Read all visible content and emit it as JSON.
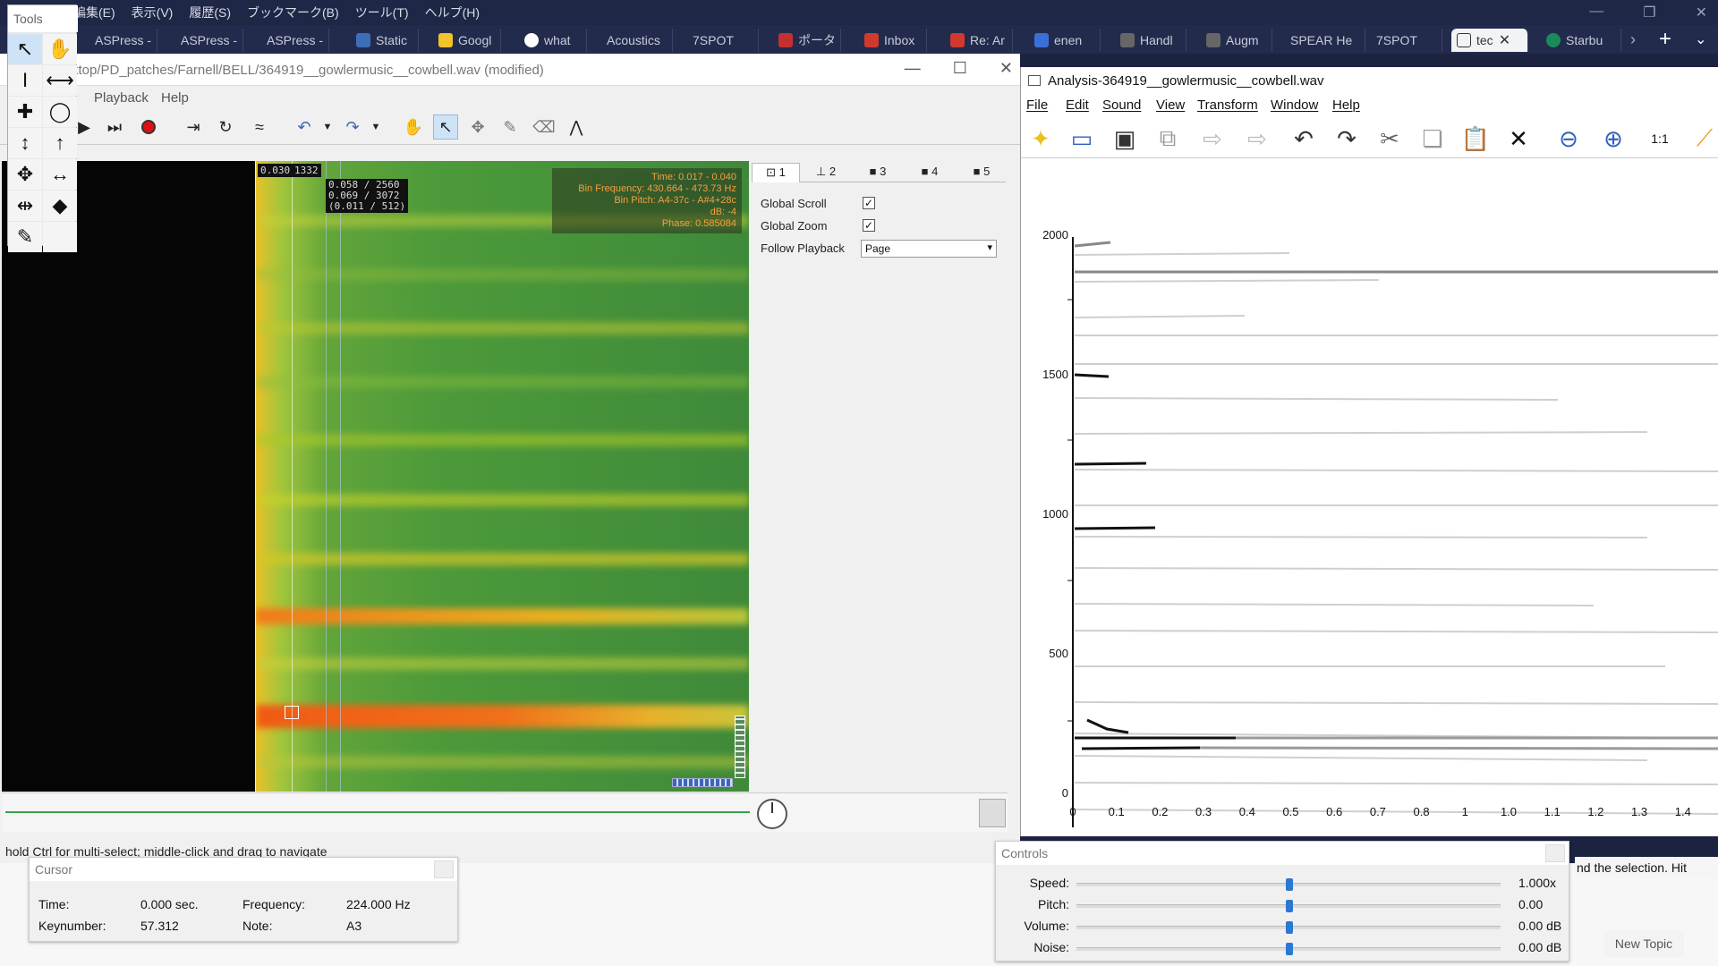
{
  "browser": {
    "menu": [
      "編集(E)",
      "表示(V)",
      "履歴(S)",
      "ブックマーク(B)",
      "ツール(T)",
      "ヘルプ(H)"
    ],
    "tabs": [
      "ASPress -",
      "ASPress -",
      "ASPress -",
      "Static",
      "Googl",
      "what",
      "Acoustics",
      "7SPOT",
      "ポータ",
      "Inbox",
      "Re: Ar",
      "enen",
      "Handl",
      "Augm",
      "SPEAR He",
      "7SPOT",
      "tec",
      "Starbu"
    ]
  },
  "tools_palette": {
    "title": "Tools"
  },
  "sv": {
    "title": "ktop/PD_patches/Farnell/BELL/364919__gowlermusic__cowbell.wav (modified)",
    "menu": [
      "Playback",
      "Help"
    ],
    "ruler": {
      "a": "0.030",
      "b": "1332",
      "c1": "0.058 / 2560",
      "c2": "0.069 / 3072",
      "c3": "(0.011 / 512)"
    },
    "info": {
      "time": "Time: 0.017 - 0.040",
      "binfreq": "Bin Frequency: 430.664 - 473.73 Hz",
      "binpitch": "Bin Pitch: A4-37c - A#4+28c",
      "db": "dB: -4",
      "phase": "Phase: 0.585084"
    },
    "tabs": [
      "1",
      "2",
      "3",
      "4",
      "5"
    ],
    "props": {
      "global_scroll": "Global Scroll",
      "global_zoom": "Global Zoom",
      "follow_playback": "Follow Playback",
      "follow_value": "Page"
    },
    "status": "hold Ctrl for multi-select; middle-click and drag to navigate"
  },
  "cursor_panel": {
    "title": "Cursor",
    "time_label": "Time:",
    "time_value": "0.000 sec.",
    "freq_label": "Frequency:",
    "freq_value": "224.000 Hz",
    "key_label": "Keynumber:",
    "key_value": "57.312",
    "note_label": "Note:",
    "note_value": "A3"
  },
  "spear": {
    "title": "Analysis-364919__gowlermusic__cowbell.wav",
    "menu": [
      "File",
      "Edit",
      "Sound",
      "View",
      "Transform",
      "Window",
      "Help"
    ],
    "yticks": [
      "2000",
      "1500",
      "1000",
      "500",
      "0"
    ],
    "xticks": [
      "0",
      "0.1",
      "0.2",
      "0.3",
      "0.4",
      "0.5",
      "0.6",
      "0.7",
      "0.8",
      "1",
      "1.0",
      "1.1",
      "1.2",
      "1.3",
      "1.4"
    ]
  },
  "controls_panel": {
    "title": "Controls",
    "rows": [
      {
        "label": "Speed:",
        "value": "1.000x"
      },
      {
        "label": "Pitch:",
        "value": "0.00"
      },
      {
        "label": "Volume:",
        "value": "0.00 dB"
      },
      {
        "label": "Noise:",
        "value": "0.00 dB"
      }
    ]
  },
  "right_status": "nd the selection.   Hit",
  "new_topic": "New Topic"
}
